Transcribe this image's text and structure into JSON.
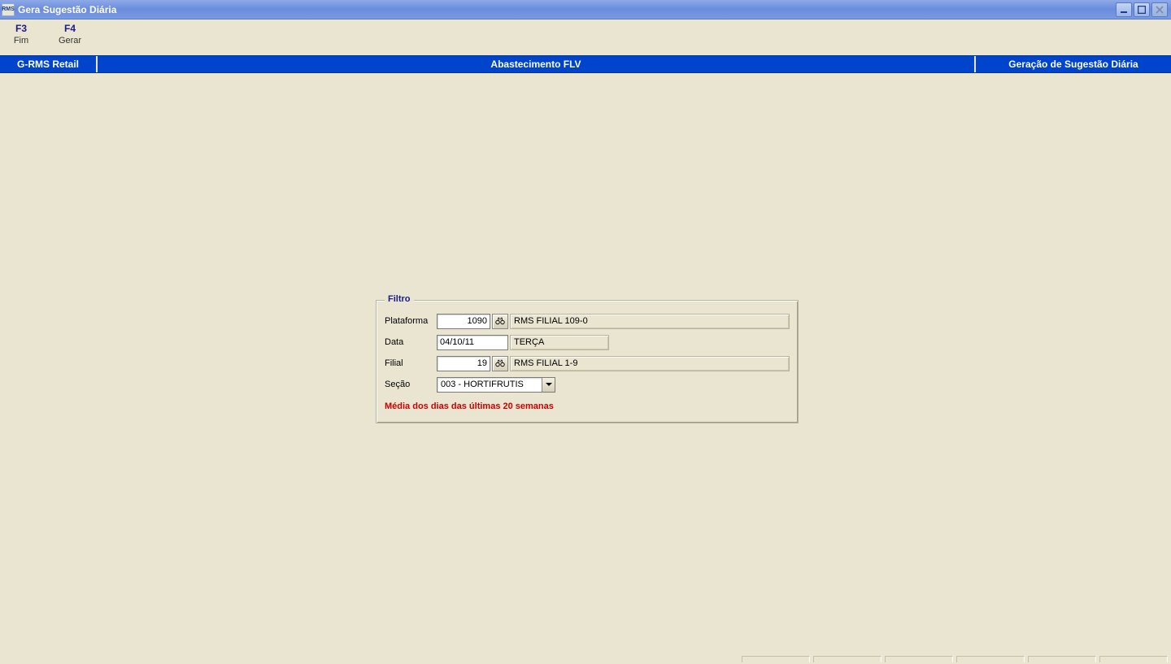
{
  "window": {
    "title": "Gera Sugestão Diária",
    "icon_text": "RMS"
  },
  "toolbar": {
    "items": [
      {
        "key": "F3",
        "label": "Fim"
      },
      {
        "key": "F4",
        "label": "Gerar"
      }
    ]
  },
  "infobar": {
    "left": "G-RMS Retail",
    "center": "Abastecimento FLV",
    "right": "Geração de Sugestão Diária"
  },
  "filter": {
    "legend": "Filtro",
    "plataforma_label": "Plataforma",
    "plataforma_value": "1090",
    "plataforma_display": "RMS FILIAL 109-0",
    "data_label": "Data",
    "data_value": "04/10/11",
    "data_display": "TERÇA",
    "filial_label": "Filial",
    "filial_value": "19",
    "filial_display": "RMS FILIAL 1-9",
    "secao_label": "Seção",
    "secao_value": "003 - HORTIFRUTIS",
    "status_msg": "Média dos dias das últimas 20 semanas"
  }
}
